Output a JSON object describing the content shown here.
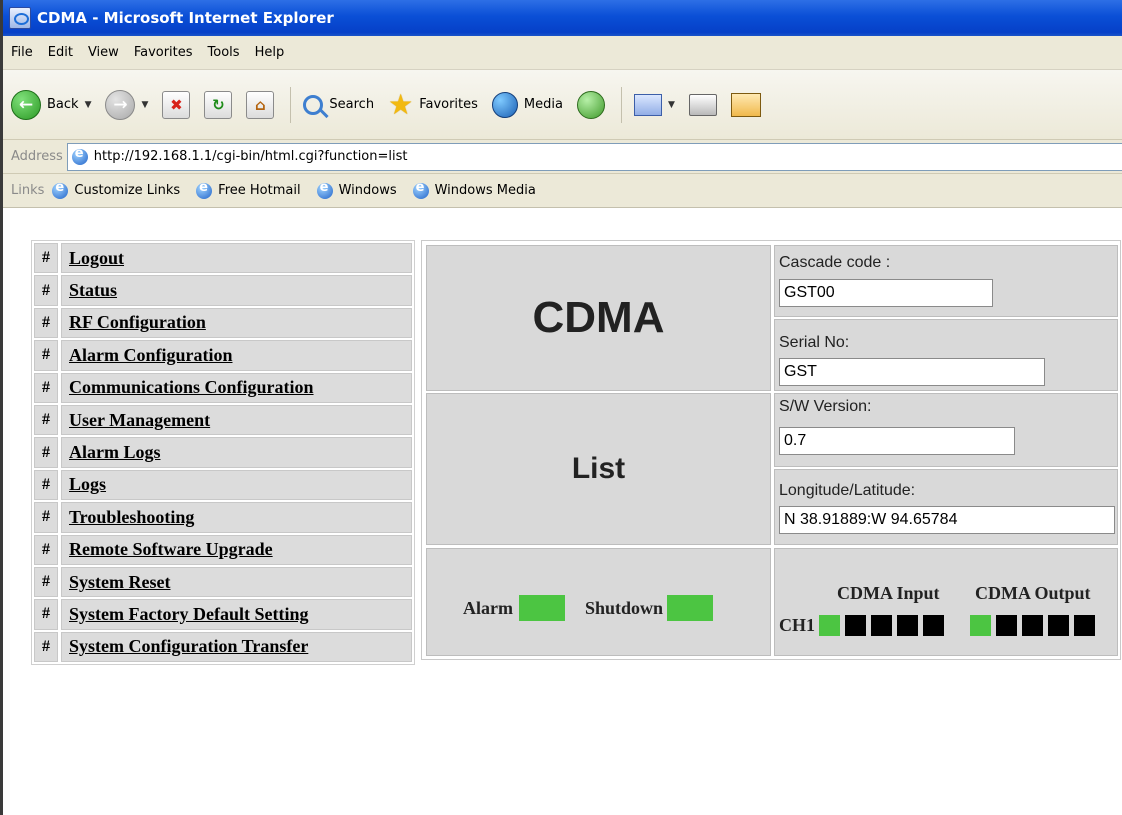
{
  "window": {
    "title": "CDMA - Microsoft Internet Explorer"
  },
  "menu": [
    "File",
    "Edit",
    "View",
    "Favorites",
    "Tools",
    "Help"
  ],
  "toolbar": {
    "back": "Back",
    "search": "Search",
    "favorites": "Favorites",
    "media": "Media"
  },
  "address": {
    "label": "Address",
    "url": "http://192.168.1.1/cgi-bin/html.cgi?function=list"
  },
  "links": {
    "label": "Links",
    "items": [
      "Customize Links",
      "Free Hotmail",
      "Windows",
      "Windows Media"
    ]
  },
  "nav": {
    "hash": "#",
    "items": [
      "Logout",
      "Status",
      "RF Configuration",
      "Alarm Configuration",
      "Communications Configuration",
      "User Management",
      "Alarm Logs",
      "Logs",
      "Troubleshooting",
      "Remote Software Upgrade",
      "System Reset",
      "System Factory Default Setting",
      "System Configuration Transfer"
    ]
  },
  "panel": {
    "title": "CDMA",
    "subtitle": "List",
    "fields": [
      {
        "label": "Cascade code :",
        "value": "GST00"
      },
      {
        "label": "Serial No:",
        "value": "GST"
      },
      {
        "label": "S/W Version:",
        "value": "0.7"
      },
      {
        "label": "Longitude/Latitude:",
        "value": "N 38.91889:W 94.65784"
      }
    ],
    "alarm_label": "Alarm",
    "shutdown_label": "Shutdown",
    "cdma_input_label": "CDMA Input",
    "cdma_output_label": "CDMA Output",
    "channel_label": "CH1",
    "led_on_color": "#4cc542",
    "led_off_color": "#000000"
  }
}
